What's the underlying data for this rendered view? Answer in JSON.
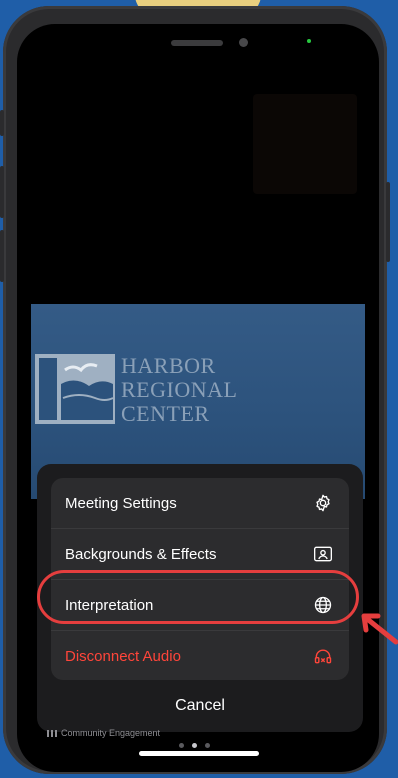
{
  "branding": {
    "logo_line1": "HARBOR",
    "logo_line2": "REGIONAL",
    "logo_line3": "CENTER"
  },
  "menu": {
    "items": [
      {
        "label": "Meeting Settings",
        "icon": "gear-icon"
      },
      {
        "label": "Backgrounds & Effects",
        "icon": "portrait-icon"
      },
      {
        "label": "Interpretation",
        "icon": "globe-icon"
      },
      {
        "label": "Disconnect Audio",
        "icon": "headphones-x-icon"
      }
    ],
    "cancel_label": "Cancel"
  },
  "participant": {
    "label": "Community Engagement"
  },
  "colors": {
    "danger": "#ff453a",
    "annotation": "#e53e3e",
    "background": "#1f5ea8"
  }
}
